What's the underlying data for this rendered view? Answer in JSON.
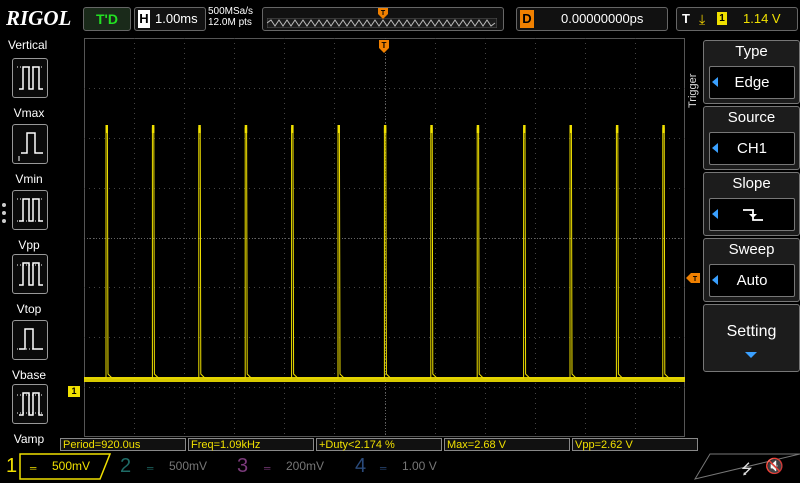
{
  "header": {
    "logo": "RIGOL",
    "run_status": "T'D",
    "timebase_letter": "H",
    "timebase": "1.00ms",
    "sample_rate": "500MSa/s",
    "memory_depth": "12.0M pts",
    "delay_letter": "D",
    "delay": "0.00000000ps",
    "trigger_letter": "T",
    "trigger_channel": "1",
    "trigger_level": "1.14 V"
  },
  "left_panel": {
    "title": "Vertical",
    "items": [
      {
        "label": "Vmax"
      },
      {
        "label": "Vmin"
      },
      {
        "label": "Vpp"
      },
      {
        "label": "Vtop"
      },
      {
        "label": "Vbase"
      },
      {
        "label": "Vamp"
      }
    ]
  },
  "waveform": {
    "channel_marker": "1",
    "pulse_count": 13
  },
  "right_menu": {
    "side_label": "Trigger",
    "items": [
      {
        "title": "Type",
        "value": "Edge"
      },
      {
        "title": "Source",
        "value": "CH1"
      },
      {
        "title": "Slope",
        "value": "⌐"
      },
      {
        "title": "Sweep",
        "value": "Auto"
      }
    ],
    "setting": "Setting"
  },
  "measurements": [
    "Period=920.0us",
    "Freq=1.09kHz",
    "+Duty<2.174 %",
    "Max=2.68 V",
    "Vpp=2.62 V"
  ],
  "channels": [
    {
      "num": "1",
      "scale": "500mV",
      "color": "#f0e000",
      "active": true
    },
    {
      "num": "2",
      "scale": "500mV",
      "color": "#1e6b66",
      "active": false
    },
    {
      "num": "3",
      "scale": "200mV",
      "color": "#7a3a7a",
      "active": false
    },
    {
      "num": "4",
      "scale": "1.00 V",
      "color": "#2a4a7a",
      "active": false
    }
  ],
  "colors": {
    "ch1": "#f0e000",
    "trigger": "#f08000",
    "accent": "#3aa0ff"
  }
}
